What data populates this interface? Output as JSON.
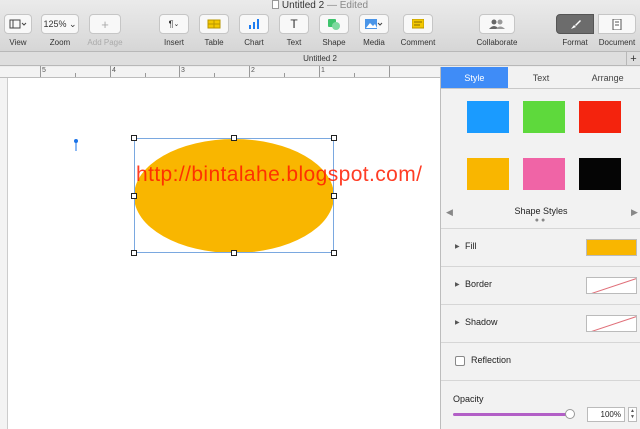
{
  "window": {
    "title": "Untitled 2",
    "edited": "— Edited"
  },
  "toolbar": {
    "view": "View",
    "zoom_value": "125%",
    "zoom": "Zoom",
    "add_page": "Add Page",
    "insert": "Insert",
    "table": "Table",
    "chart": "Chart",
    "text": "Text",
    "shape": "Shape",
    "media": "Media",
    "comment": "Comment",
    "collaborate": "Collaborate",
    "format": "Format",
    "document": "Document"
  },
  "tab": {
    "title": "Untitled 2",
    "plus": "+"
  },
  "ruler": {
    "numbers": [
      "5",
      "4",
      "3",
      "2",
      "1"
    ]
  },
  "canvas": {
    "watermark": "http://bintalahe.blogspot.com/"
  },
  "panel": {
    "tabs": [
      "Style",
      "Text",
      "Arrange"
    ],
    "shape_styles_label": "Shape Styles",
    "swatches": [
      "#1a9bff",
      "#5ed93c",
      "#f4230d",
      "#f9b600",
      "#f064a6",
      "#050505"
    ],
    "fill_label": "Fill",
    "fill_color": "#f9b600",
    "border_label": "Border",
    "shadow_label": "Shadow",
    "reflection_label": "Reflection",
    "opacity_label": "Opacity",
    "opacity_value": "100%"
  }
}
